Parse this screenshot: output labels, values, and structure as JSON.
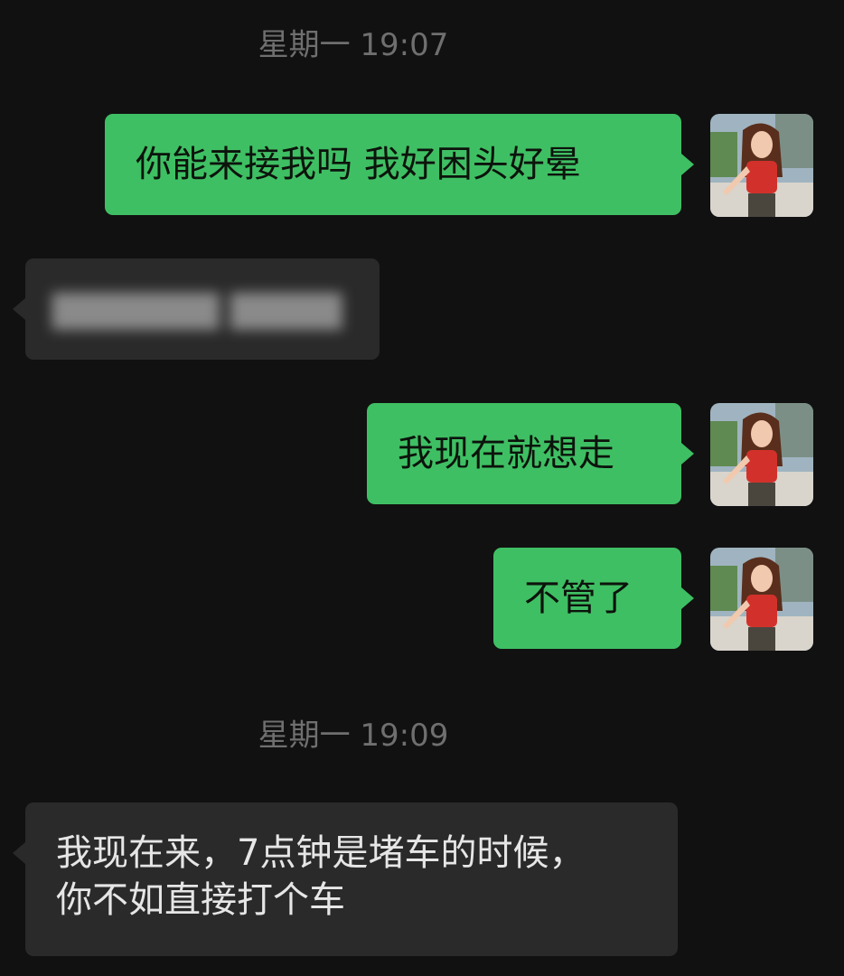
{
  "chat": {
    "timestamps": [
      "星期一 19:07",
      "星期一 19:09"
    ],
    "messages": [
      {
        "side": "out",
        "text": "你能来接我吗 我好困头好晕"
      },
      {
        "side": "in",
        "text": "",
        "redacted": true
      },
      {
        "side": "out",
        "text": "我现在就想走"
      },
      {
        "side": "out",
        "text": "不管了"
      },
      {
        "side": "in",
        "lines": [
          "我现在来，7点钟是堵车的时候，",
          "你不如直接打个车"
        ]
      }
    ]
  },
  "avatar": {
    "icon": "user-avatar-icon"
  },
  "colors": {
    "background": "#111111",
    "outgoing_bubble": "#3fbf63",
    "incoming_bubble": "#2a2a2a",
    "timestamp": "#6f6f6f"
  }
}
